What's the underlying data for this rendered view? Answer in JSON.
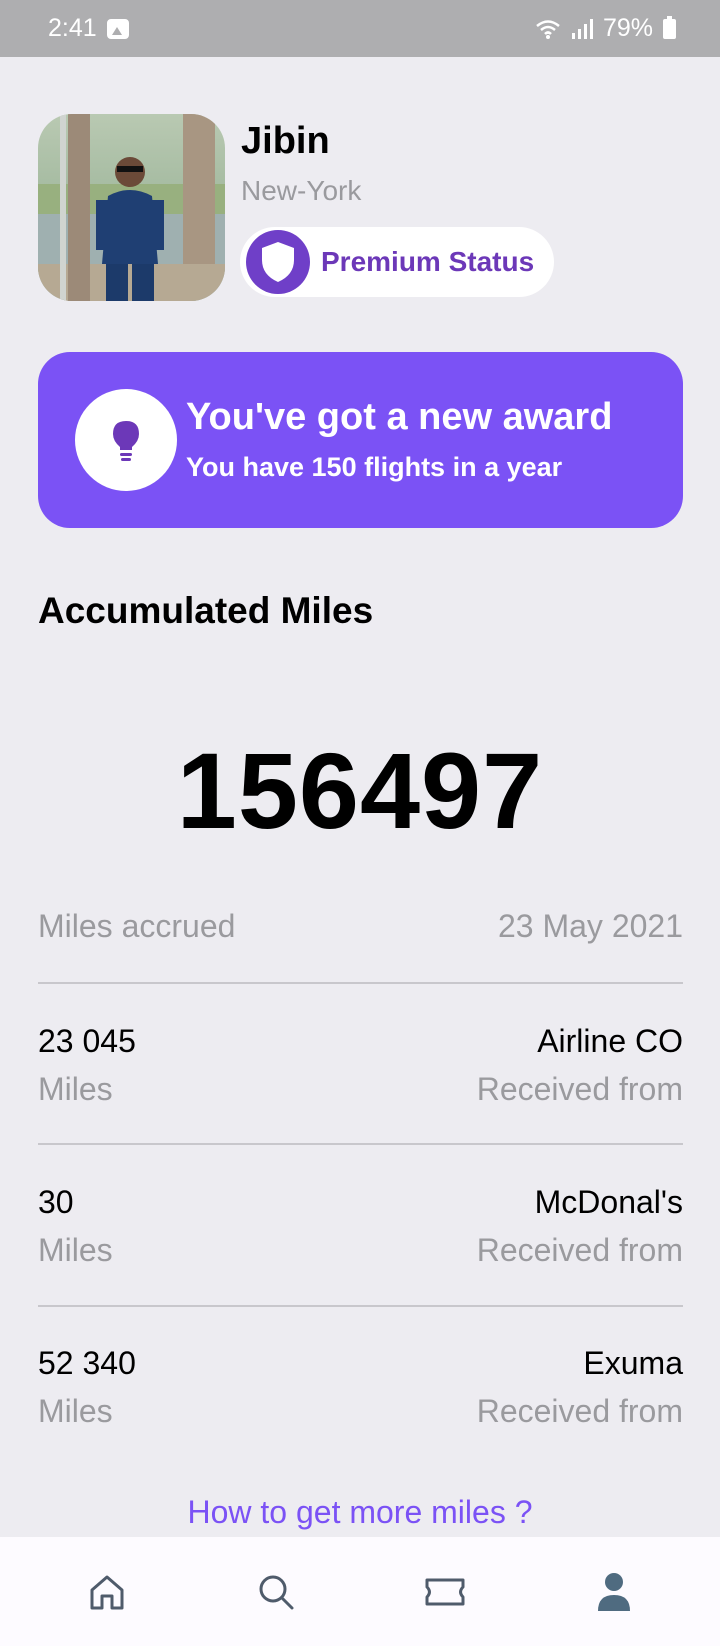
{
  "status_bar": {
    "time": "2:41",
    "battery": "79%",
    "icons": [
      "gallery-icon",
      "wifi-icon",
      "signal-icon",
      "battery-icon"
    ]
  },
  "profile": {
    "name": "Jibin",
    "city": "New-York",
    "status_label": "Premium Status",
    "status_icon": "shield-icon"
  },
  "award": {
    "title": "You've got a new award",
    "subtitle": "You have 150 flights in a year",
    "icon": "lightbulb-icon"
  },
  "miles": {
    "section_title": "Accumulated Miles",
    "total": "156497",
    "accrued_label": "Miles accrued",
    "accrued_date": "23 May 2021",
    "entries": [
      {
        "amount": "23 045",
        "unit": "Miles",
        "source": "Airline CO",
        "source_label": "Received from"
      },
      {
        "amount": "30",
        "unit": "Miles",
        "source": "McDonal's",
        "source_label": "Received from"
      },
      {
        "amount": "52 340",
        "unit": "Miles",
        "source": "Exuma",
        "source_label": "Received from"
      }
    ],
    "more_link": "How to get more miles ?"
  },
  "nav": {
    "items": [
      "home-icon",
      "search-icon",
      "ticket-icon",
      "profile-icon"
    ]
  },
  "colors": {
    "accent": "#7b52f5",
    "premium_text": "#6c38b8",
    "background": "#edecf1",
    "muted_text": "#9a9a9e"
  }
}
